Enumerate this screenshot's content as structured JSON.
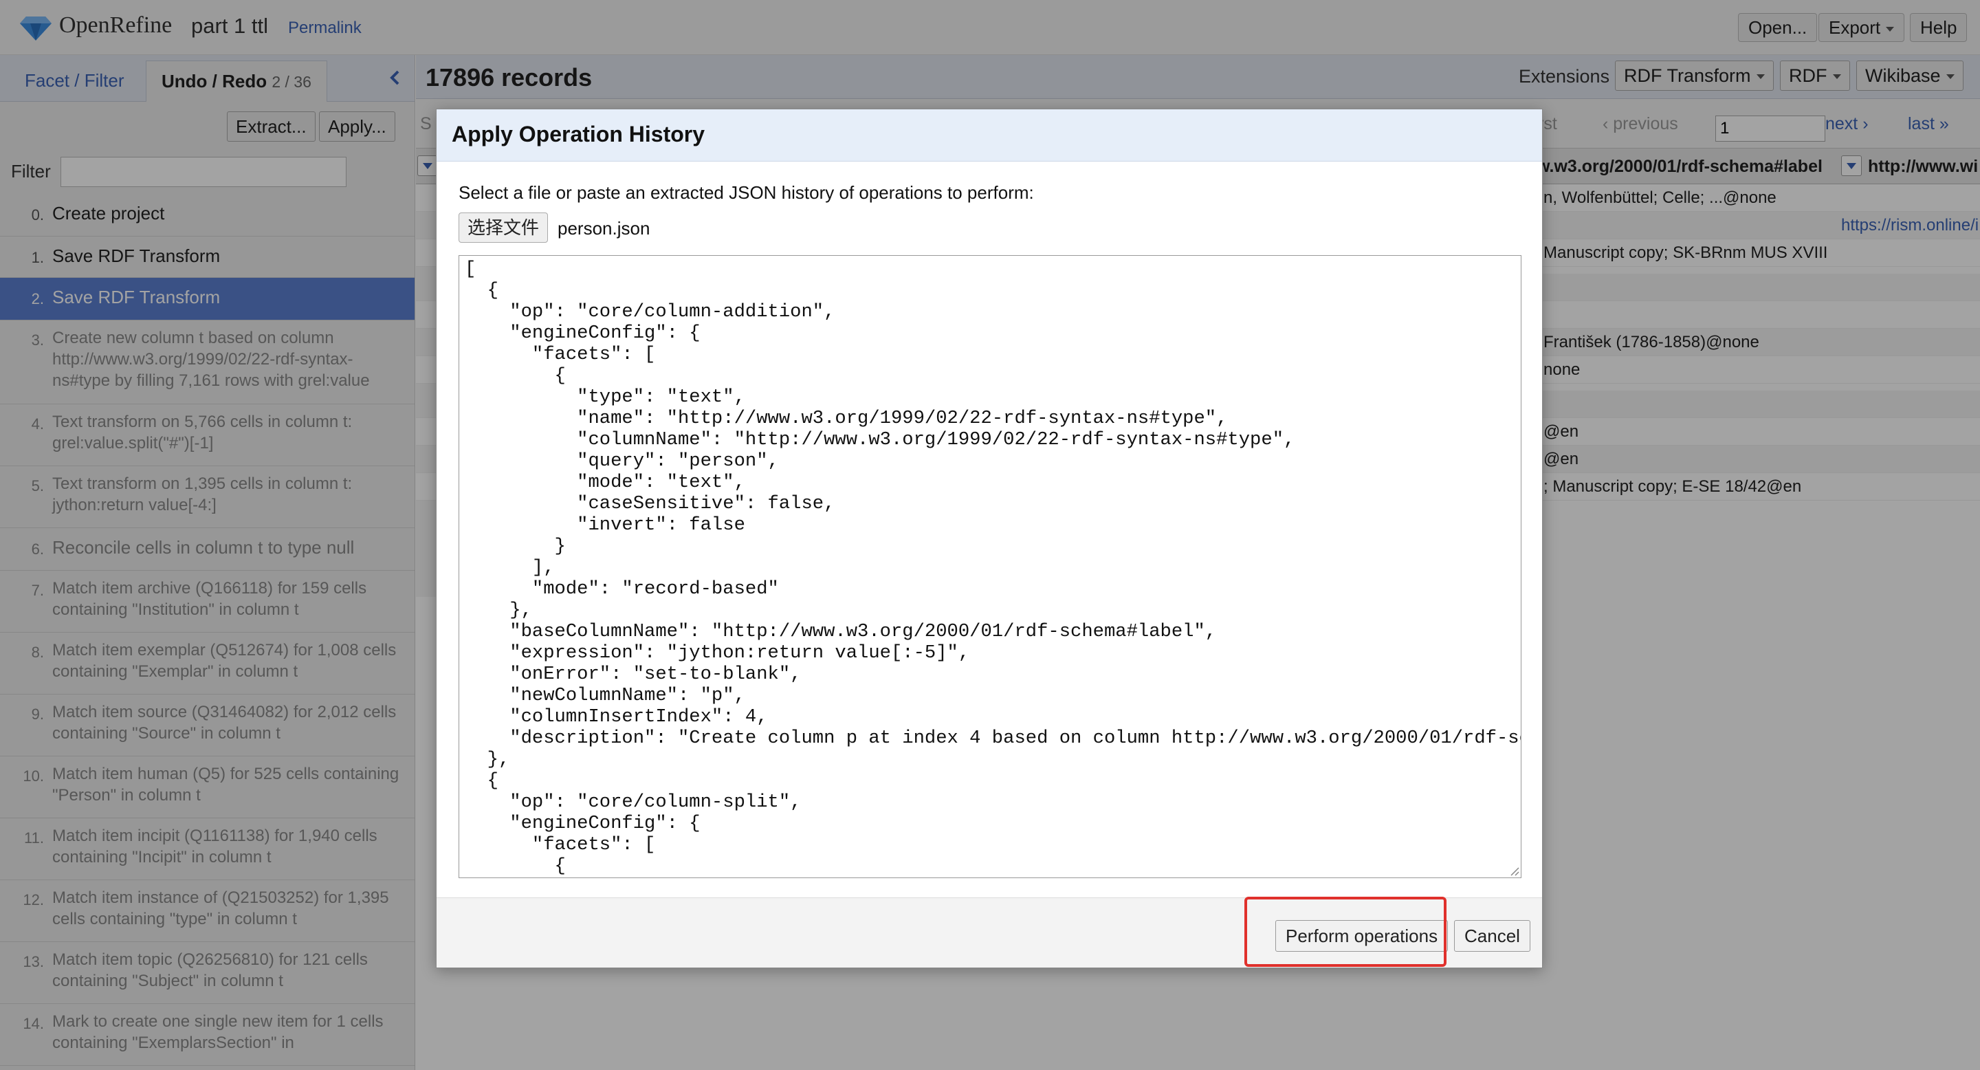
{
  "header": {
    "app_name": "OpenRefine",
    "project_name": "part 1 ttl",
    "permalink": "Permalink",
    "open_label": "Open...",
    "export_label": "Export",
    "help_label": "Help"
  },
  "left_panel": {
    "tab_facet": "Facet / Filter",
    "tab_undo": "Undo / Redo",
    "undo_count": "2 / 36",
    "extract_label": "Extract...",
    "apply_label": "Apply...",
    "filter_label": "Filter",
    "filter_value": "",
    "history": [
      {
        "num": "0.",
        "text": "Create project",
        "state": "done"
      },
      {
        "num": "1.",
        "text": "Save RDF Transform",
        "state": "done"
      },
      {
        "num": "2.",
        "text": "Save RDF Transform",
        "state": "current"
      },
      {
        "num": "3.",
        "text": "Create new column t based on column http://www.w3.org/1999/02/22-rdf-syntax-ns#type by filling 7,161 rows with grel:value",
        "state": "undone"
      },
      {
        "num": "4.",
        "text": "Text transform on 5,766 cells in column t: grel:value.split(\"#\")[-1]",
        "state": "undone"
      },
      {
        "num": "5.",
        "text": "Text transform on 1,395 cells in column t: jython:return value[-4:]",
        "state": "undone"
      },
      {
        "num": "6.",
        "text": "Reconcile cells in column t to type null",
        "state": "undone"
      },
      {
        "num": "7.",
        "text": "Match item archive (Q166118) for 159 cells containing \"Institution\" in column t",
        "state": "undone"
      },
      {
        "num": "8.",
        "text": "Match item exemplar (Q512674) for 1,008 cells containing \"Exemplar\" in column t",
        "state": "undone"
      },
      {
        "num": "9.",
        "text": "Match item source (Q31464082) for 2,012 cells containing \"Source\" in column t",
        "state": "undone"
      },
      {
        "num": "10.",
        "text": "Match item human (Q5) for 525 cells containing \"Person\" in column t",
        "state": "undone"
      },
      {
        "num": "11.",
        "text": "Match item incipit (Q1161138) for 1,940 cells containing \"Incipit\" in column t",
        "state": "undone"
      },
      {
        "num": "12.",
        "text": "Match item instance of (Q21503252) for 1,395 cells containing \"type\" in column t",
        "state": "undone"
      },
      {
        "num": "13.",
        "text": "Match item topic (Q26256810) for 121 cells containing \"Subject\" in column t",
        "state": "undone"
      },
      {
        "num": "14.",
        "text": "Mark to create one single new item for 1 cells containing \"ExemplarsSection\" in",
        "state": "undone"
      }
    ]
  },
  "data_panel": {
    "record_count": "17896 records",
    "extensions_label": "Extensions",
    "rdf_transform_label": "RDF Transform",
    "rdf_label": "RDF",
    "wikibase_label": "Wikibase",
    "pager": {
      "first": "rst",
      "previous": "‹ previous",
      "page": "1",
      "next": "next ›",
      "last": "last »"
    },
    "col_partial": "S",
    "col_label": "w.w3.org/2000/01/rdf-schema#label",
    "col_next": "http://www.wi",
    "rows": [
      {
        "label": "n, Wolfenbüttel; Celle; ...@none",
        "link": ""
      },
      {
        "label": "",
        "link": "https://rism.online/i"
      },
      {
        "label": "Manuscript copy; SK-BRnm MUS XVIII",
        "link": ""
      },
      {
        "label": "",
        "link": ""
      },
      {
        "label": "",
        "link": ""
      },
      {
        "label": " František (1786-1858)@none",
        "link": ""
      },
      {
        "label": "none",
        "link": ""
      },
      {
        "label": "",
        "link": ""
      },
      {
        "label": "@en",
        "link": ""
      },
      {
        "label": "@en",
        "link": ""
      },
      {
        "label": "; Manuscript copy; E-SE 18/42@en",
        "link": ""
      }
    ]
  },
  "dialog": {
    "title": "Apply Operation History",
    "instructions": "Select a file or paste an extracted JSON history of operations to perform:",
    "file_button": "选择文件",
    "file_name": "person.json",
    "json_text": "[\n  {\n    \"op\": \"core/column-addition\",\n    \"engineConfig\": {\n      \"facets\": [\n        {\n          \"type\": \"text\",\n          \"name\": \"http://www.w3.org/1999/02/22-rdf-syntax-ns#type\",\n          \"columnName\": \"http://www.w3.org/1999/02/22-rdf-syntax-ns#type\",\n          \"query\": \"person\",\n          \"mode\": \"text\",\n          \"caseSensitive\": false,\n          \"invert\": false\n        }\n      ],\n      \"mode\": \"record-based\"\n    },\n    \"baseColumnName\": \"http://www.w3.org/2000/01/rdf-schema#label\",\n    \"expression\": \"jython:return value[:-5]\",\n    \"onError\": \"set-to-blank\",\n    \"newColumnName\": \"p\",\n    \"columnInsertIndex\": 4,\n    \"description\": \"Create column p at index 4 based on column http://www.w3.org/2000/01/rdf-sch\n  },\n  {\n    \"op\": \"core/column-split\",\n    \"engineConfig\": {\n      \"facets\": [\n        {",
    "perform_label": "Perform operations",
    "cancel_label": "Cancel"
  },
  "colors": {
    "link": "#3a62b4",
    "current_history_bg": "#5b7fd0",
    "highlight": "#e0312c"
  }
}
